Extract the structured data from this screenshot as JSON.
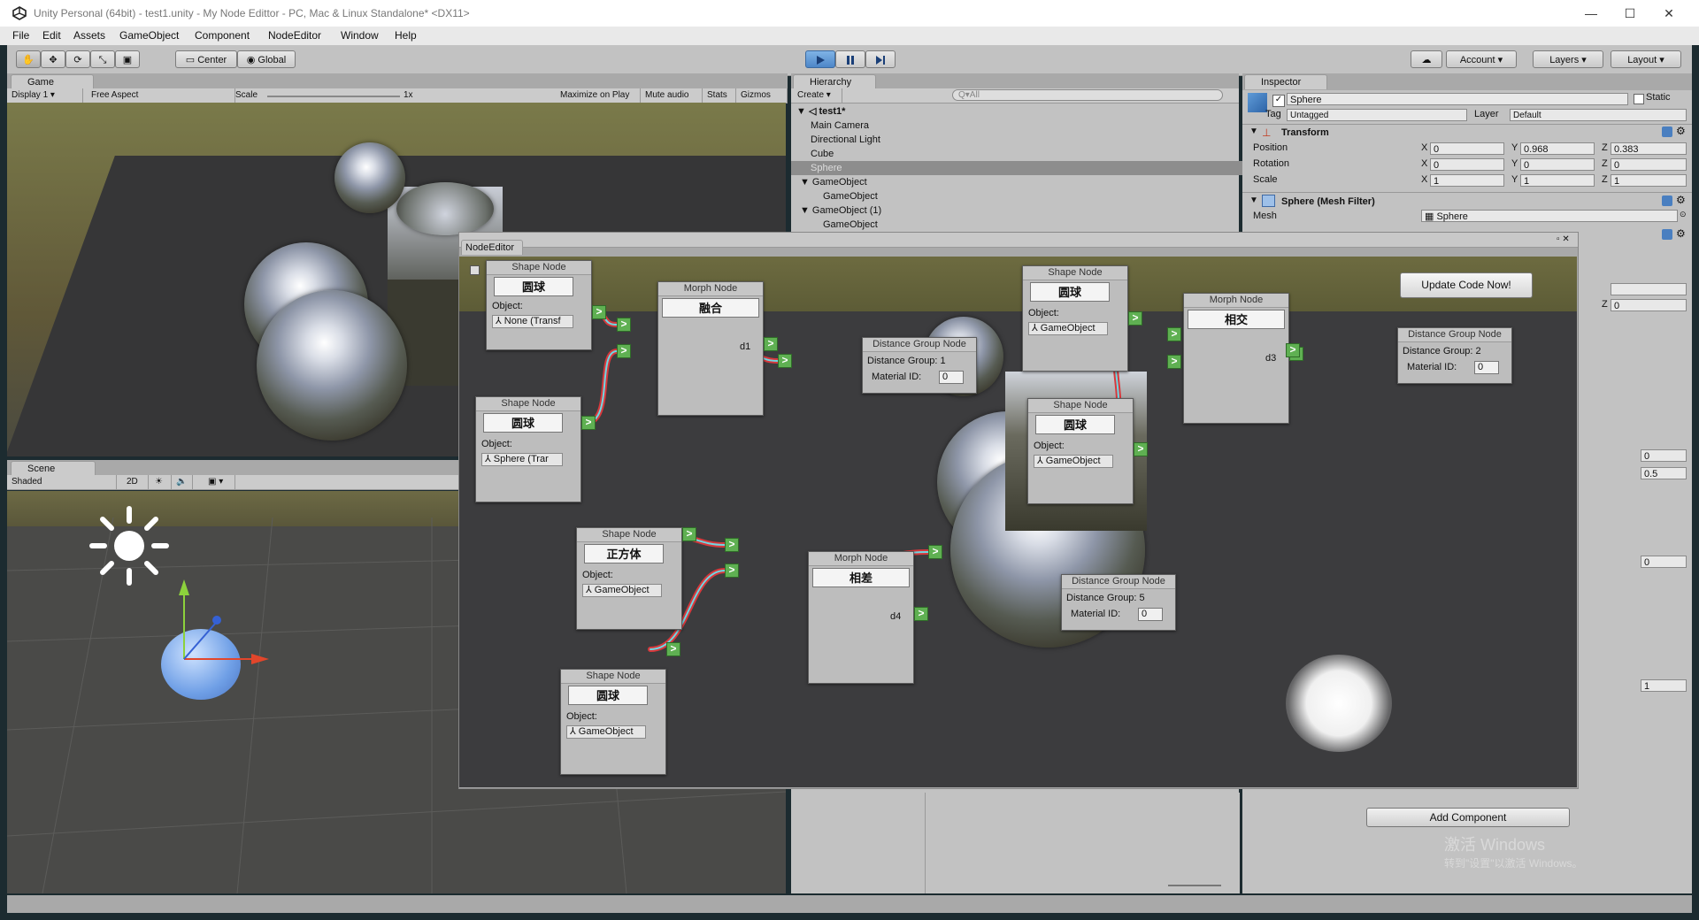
{
  "window": {
    "title": "Unity Personal (64bit) - test1.unity - My Node Edittor - PC, Mac & Linux Standalone* <DX11>",
    "controls": [
      "—",
      "☐",
      "✕"
    ]
  },
  "menubar": [
    "File",
    "Edit",
    "Assets",
    "GameObject",
    "Component",
    "NodeEditor",
    "Window",
    "Help"
  ],
  "toolbar": {
    "pivot": "Center",
    "space": "Global",
    "account": "Account",
    "layers": "Layers",
    "layout": "Layout"
  },
  "game": {
    "tab": "Game",
    "display": "Display 1",
    "aspect": "Free Aspect",
    "scale_label": "Scale",
    "scale_value": "1x",
    "buttons": [
      "Maximize on Play",
      "Mute audio",
      "Stats",
      "Gizmos"
    ]
  },
  "scene": {
    "tab": "Scene",
    "shading": "Shaded",
    "mode2d": "2D"
  },
  "hierarchy": {
    "tab": "Hierarchy",
    "create": "Create",
    "search_placeholder": "Q▾All",
    "scene_name": "test1*",
    "items": [
      {
        "label": "Main Camera",
        "indent": 1,
        "arrow": ""
      },
      {
        "label": "Directional Light",
        "indent": 1,
        "arrow": ""
      },
      {
        "label": "Cube",
        "indent": 1,
        "arrow": ""
      },
      {
        "label": "Sphere",
        "indent": 1,
        "arrow": "",
        "selected": true
      },
      {
        "label": "GameObject",
        "indent": 1,
        "arrow": "▼"
      },
      {
        "label": "GameObject",
        "indent": 2,
        "arrow": ""
      },
      {
        "label": "GameObject (1)",
        "indent": 1,
        "arrow": "▼"
      },
      {
        "label": "GameObject",
        "indent": 2,
        "arrow": ""
      }
    ]
  },
  "inspector": {
    "tab": "Inspector",
    "object_name": "Sphere",
    "static_label": "Static",
    "tag_label": "Tag",
    "tag_value": "Untagged",
    "layer_label": "Layer",
    "layer_value": "Default",
    "transform_title": "Transform",
    "position_label": "Position",
    "rotation_label": "Rotation",
    "scale_label": "Scale",
    "position": {
      "x": "0",
      "y": "0.968",
      "z": "0.383"
    },
    "rotation": {
      "x": "0",
      "y": "0",
      "z": "0"
    },
    "scale": {
      "x": "1",
      "y": "1",
      "z": "1"
    },
    "mesh_filter_title": "Sphere (Mesh Filter)",
    "mesh_label": "Mesh",
    "mesh_value": "Sphere",
    "hidden_z": "0",
    "values_right": [
      "0",
      "0.5",
      "0",
      "1"
    ],
    "add_component": "Add Component",
    "watermark_1": "激活 Windows",
    "watermark_2": "转到\"设置\"以激活 Windows。"
  },
  "node_editor": {
    "title": "NodeEditor",
    "update_button": "Update Code Now!",
    "shape_header": "Shape Node",
    "morph_header": "Morph Node",
    "distance_header": "Distance Group Node",
    "object_label": "Object:",
    "distance_group_label": "Distance Group:",
    "material_label": "Material ID:",
    "shape_nodes": [
      {
        "shape": "圆球",
        "object": "None (Transf"
      },
      {
        "shape": "圆球",
        "object": "Sphere (Trar"
      },
      {
        "shape": "正方体",
        "object": "GameObject"
      },
      {
        "shape": "圆球",
        "object": "GameObject"
      },
      {
        "shape": "圆球",
        "object": "GameObject"
      },
      {
        "shape": "圆球",
        "object": "GameObject"
      }
    ],
    "morph_nodes": [
      {
        "op": "融合",
        "out": "d1"
      },
      {
        "op": "相差",
        "out": "d4"
      },
      {
        "op": "相交",
        "out": "d3"
      }
    ],
    "distance_nodes": [
      {
        "group": "1",
        "material": "0"
      },
      {
        "group": "5",
        "material": "0"
      },
      {
        "group": "2",
        "material": "0"
      }
    ]
  },
  "colors": {
    "connection_outer": "#d8383c",
    "connection_inner": "#6fd7e2",
    "port": "#5fb052",
    "play_button": "#4d86c8"
  }
}
